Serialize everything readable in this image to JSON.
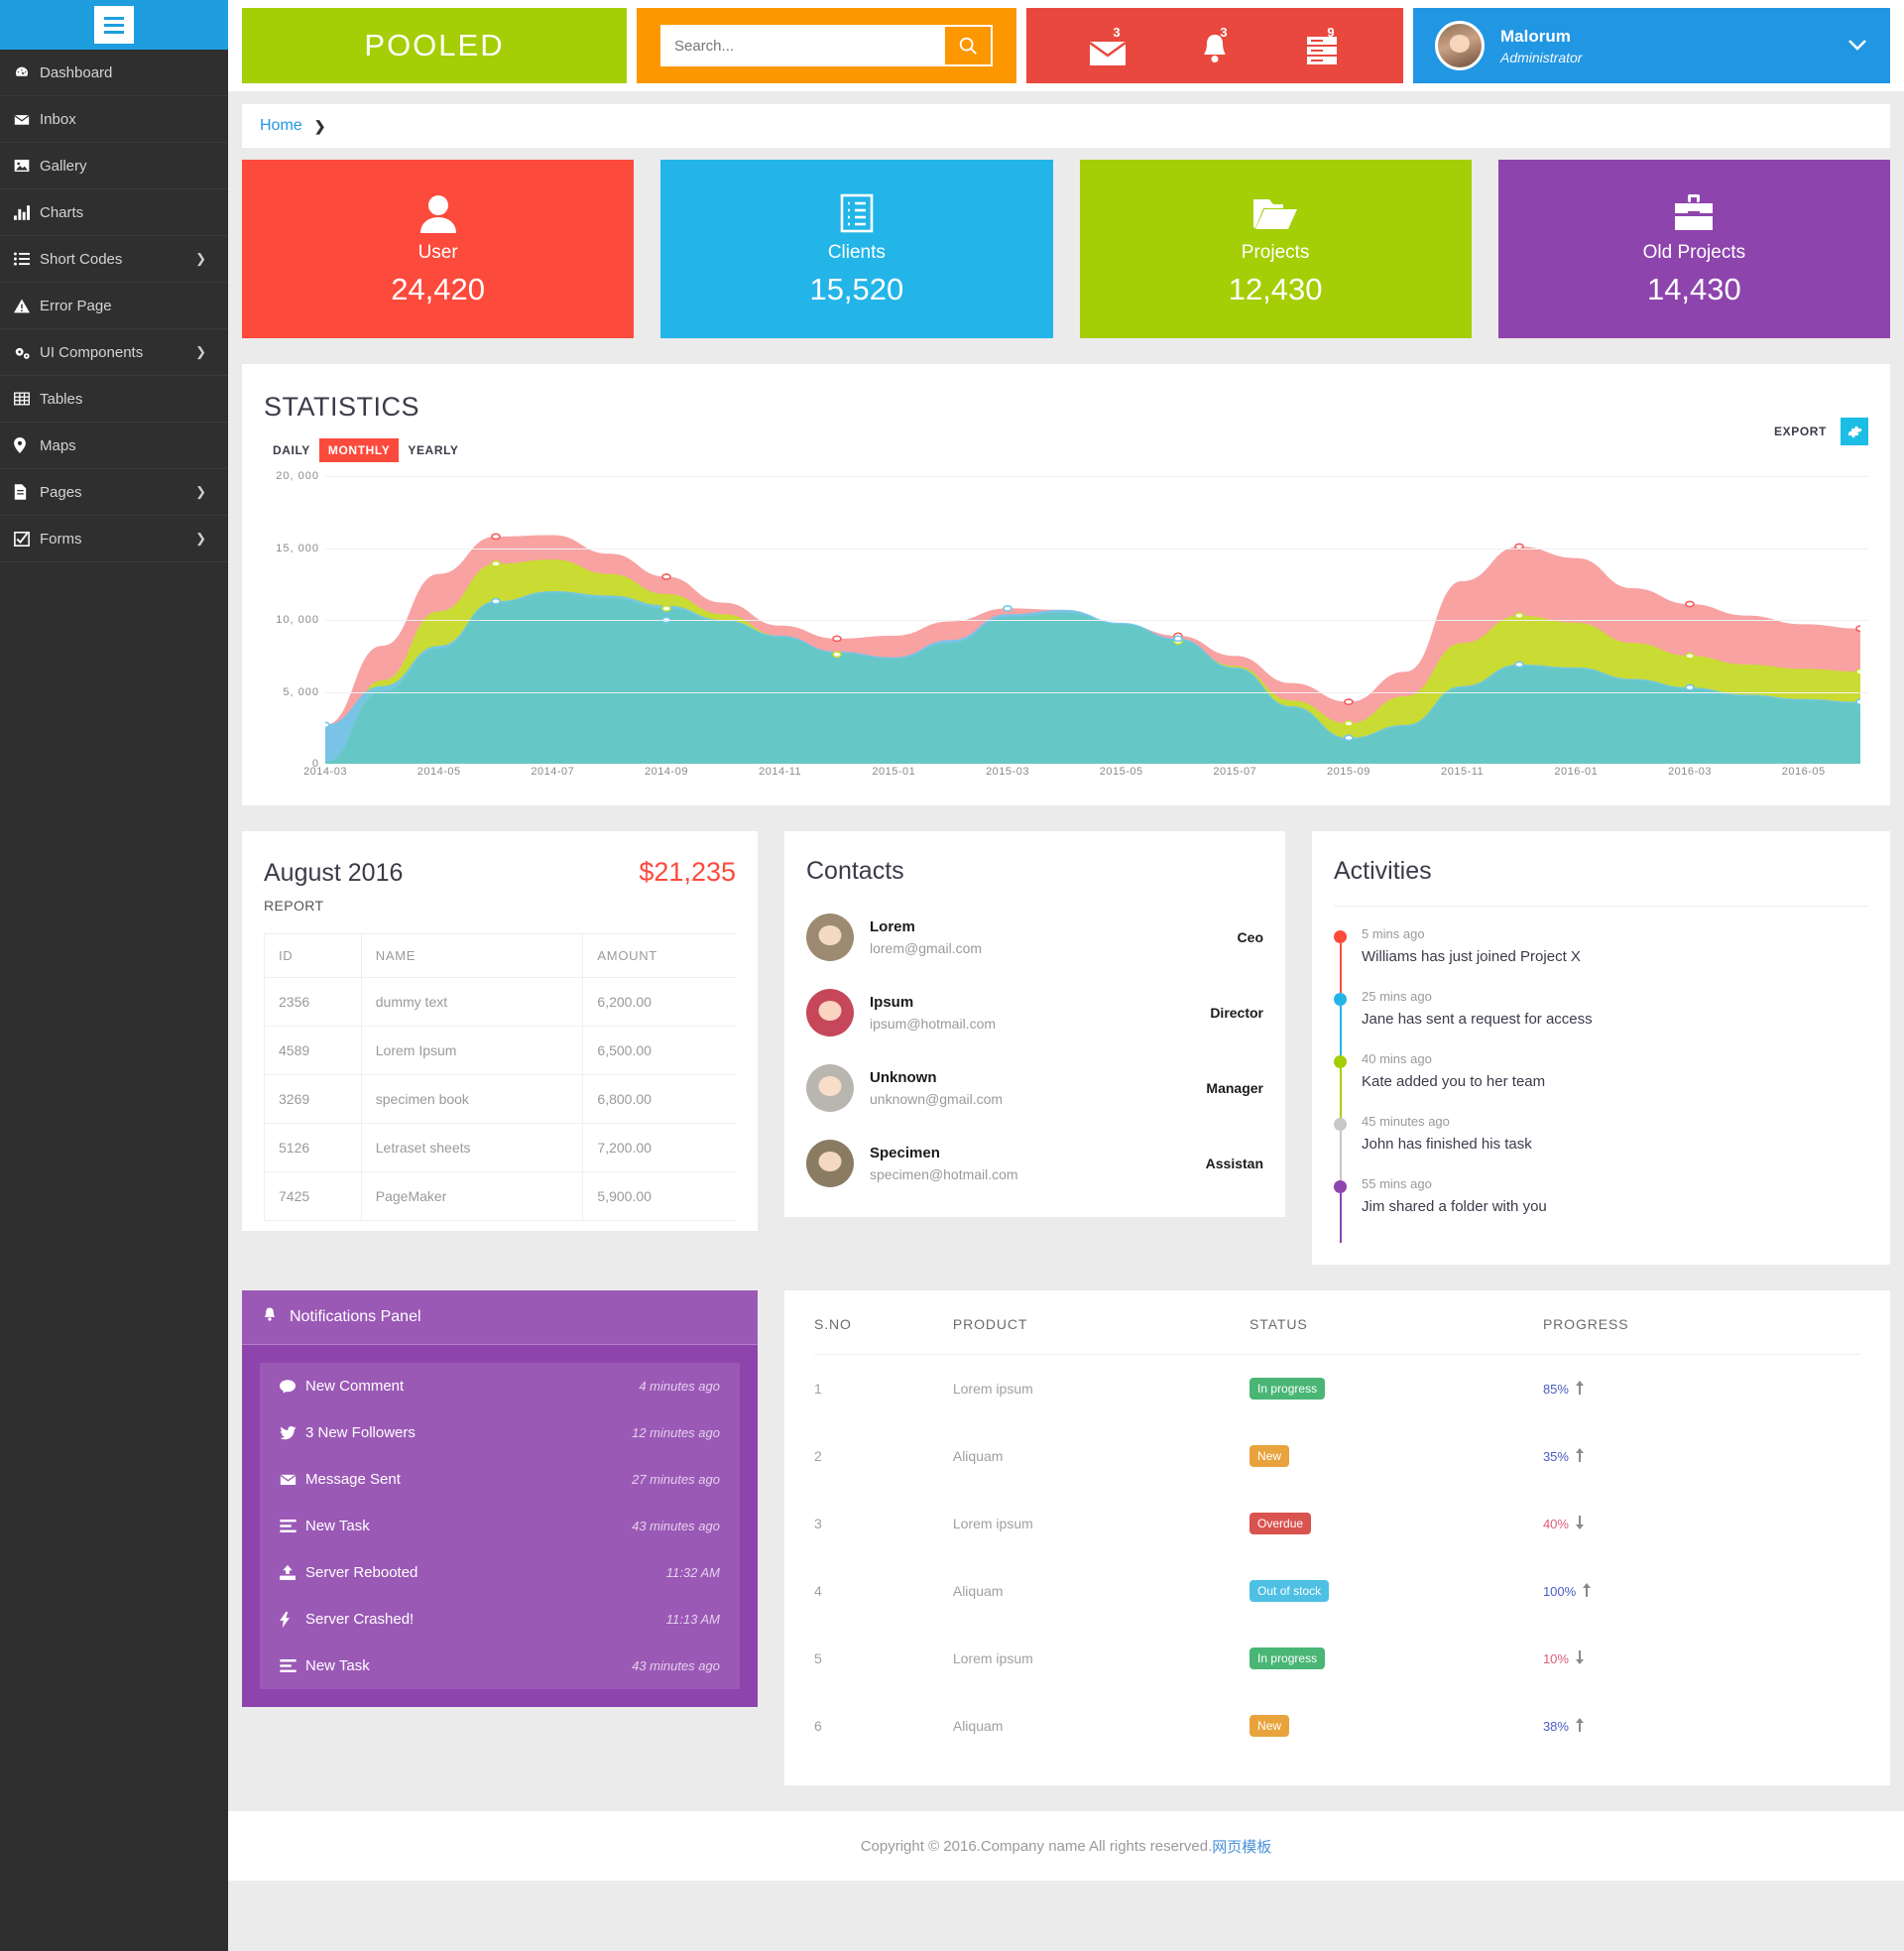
{
  "sidebar": {
    "menu_icon": "hamburger-icon",
    "items": [
      {
        "label": "Dashboard",
        "icon": "dashboard-icon",
        "arrow": ""
      },
      {
        "label": "Inbox",
        "icon": "envelope-icon",
        "arrow": ""
      },
      {
        "label": "Gallery",
        "icon": "image-icon",
        "arrow": ""
      },
      {
        "label": "Charts",
        "icon": "bar-chart-icon",
        "arrow": ""
      },
      {
        "label": "Short Codes",
        "icon": "list-icon",
        "arrow": "❯"
      },
      {
        "label": "Error Page",
        "icon": "warning-icon",
        "arrow": ""
      },
      {
        "label": "UI Components",
        "icon": "gears-icon",
        "arrow": "❯"
      },
      {
        "label": "Tables",
        "icon": "table-icon",
        "arrow": ""
      },
      {
        "label": "Maps",
        "icon": "map-pin-icon",
        "arrow": ""
      },
      {
        "label": "Pages",
        "icon": "file-icon",
        "arrow": "❯"
      },
      {
        "label": "Forms",
        "icon": "checkbox-icon",
        "arrow": "❯"
      }
    ]
  },
  "header": {
    "logo": "POOLED",
    "search": {
      "placeholder": "Search...",
      "value": "",
      "icon": "search-icon"
    },
    "alerts": [
      {
        "icon": "mail-icon",
        "count": "3",
        "badge_color": "#ee7b22"
      },
      {
        "icon": "bell-icon",
        "count": "3",
        "badge_color": "#1e75bb"
      },
      {
        "icon": "server-icon",
        "count": "9",
        "badge_color": "#6aa80e"
      }
    ],
    "user": {
      "name": "Malorum",
      "role": "Administrator",
      "avatar": "user-avatar",
      "caret": "chevron-down-icon"
    }
  },
  "breadcrumb": {
    "home": "Home",
    "separator": "❯"
  },
  "stat_cards": [
    {
      "label": "User",
      "value": "24,420",
      "color": "#fc4a3c",
      "icon": "person-icon"
    },
    {
      "label": "Clients",
      "value": "15,520",
      "color": "#23b5e8",
      "icon": "clipboard-list-icon"
    },
    {
      "label": "Projects",
      "value": "12,430",
      "color": "#a4ce06",
      "icon": "folder-open-icon"
    },
    {
      "label": "Old Projects",
      "value": "14,430",
      "color": "#8e44ad",
      "icon": "briefcase-icon"
    }
  ],
  "statistics": {
    "title": "STATISTICS",
    "ranges": [
      {
        "label": "DAILY",
        "active": false
      },
      {
        "label": "MONTHLY",
        "active": true
      },
      {
        "label": "YEARLY",
        "active": false
      }
    ],
    "export_label": "EXPORT",
    "settings_icon": "gear-icon"
  },
  "chart_data": {
    "type": "area",
    "title": "STATISTICS",
    "xlabel": "",
    "ylabel": "",
    "ylim": [
      0,
      20000
    ],
    "yticks": [
      0,
      5000,
      10000,
      15000,
      20000
    ],
    "ytick_labels": [
      "0",
      "5, 000",
      "10, 000",
      "15, 000",
      "20, 000"
    ],
    "grid": true,
    "legend": "none",
    "stacked": false,
    "x": [
      "2014-03",
      "2014-04",
      "2014-05",
      "2014-06",
      "2014-07",
      "2014-08",
      "2014-09",
      "2014-10",
      "2014-11",
      "2014-12",
      "2015-01",
      "2015-02",
      "2015-03",
      "2015-04",
      "2015-05",
      "2015-06",
      "2015-07",
      "2015-08",
      "2015-09",
      "2015-10",
      "2015-11",
      "2015-12",
      "2016-01",
      "2016-02",
      "2016-03",
      "2016-04",
      "2016-05",
      "2016-06"
    ],
    "xtick_labels": [
      "2014-03",
      "2014-05",
      "2014-07",
      "2014-09",
      "2014-11",
      "2015-01",
      "2015-03",
      "2015-05",
      "2015-07",
      "2015-09",
      "2015-11",
      "2016-01",
      "2016-03",
      "2016-05"
    ],
    "series": [
      {
        "name": "red",
        "color": "#f79a9a",
        "values": [
          2700,
          8200,
          13200,
          15800,
          15900,
          14600,
          13000,
          11200,
          9600,
          8700,
          8900,
          9900,
          10800,
          10700,
          9700,
          8900,
          7500,
          5600,
          4300,
          6400,
          12700,
          15100,
          14300,
          12200,
          11100,
          10300,
          9700,
          9400
        ]
      },
      {
        "name": "green",
        "color": "#c6e02a",
        "values": [
          200,
          5800,
          10600,
          13900,
          14200,
          13200,
          11800,
          10400,
          8900,
          7600,
          7000,
          7800,
          9400,
          10000,
          9300,
          8500,
          6800,
          4400,
          2800,
          4700,
          8400,
          10300,
          9800,
          8400,
          7500,
          6900,
          6600,
          6400
        ]
      },
      {
        "name": "blue",
        "color": "#6ec6ec",
        "values": [
          2700,
          5400,
          8200,
          11300,
          12000,
          11700,
          11000,
          10000,
          8900,
          7800,
          7400,
          8600,
          10400,
          10700,
          9800,
          8700,
          6700,
          4000,
          1800,
          2700,
          5400,
          6900,
          6700,
          5900,
          5300,
          4800,
          4500,
          4300
        ]
      },
      {
        "name": "teal",
        "color": "#64c8c3",
        "values": [
          100,
          5000,
          8000,
          11200,
          11900,
          11500,
          10800,
          9900,
          8800,
          7700,
          7300,
          8400,
          10200,
          10500,
          9700,
          8600,
          6600,
          3900,
          1700,
          2600,
          5300,
          6800,
          6600,
          5800,
          5200,
          4700,
          4400,
          4200
        ]
      }
    ],
    "markers": [
      {
        "x": "2014-03",
        "y": 2700,
        "color": "#6ec6ec"
      },
      {
        "x": "2014-06",
        "y": 15800,
        "color": "#f35c5c"
      },
      {
        "x": "2014-06",
        "y": 13900,
        "color": "#c6e02a"
      },
      {
        "x": "2014-06",
        "y": 11300,
        "color": "#6ec6ec"
      },
      {
        "x": "2014-09",
        "y": 13000,
        "color": "#f35c5c"
      },
      {
        "x": "2014-09",
        "y": 10800,
        "color": "#c6e02a"
      },
      {
        "x": "2014-09",
        "y": 10000,
        "color": "#6ec6ec"
      },
      {
        "x": "2014-12",
        "y": 8700,
        "color": "#f35c5c"
      },
      {
        "x": "2014-12",
        "y": 7600,
        "color": "#c6e02a"
      },
      {
        "x": "2015-03",
        "y": 10800,
        "color": "#6ec6ec"
      },
      {
        "x": "2015-06",
        "y": 8900,
        "color": "#f35c5c"
      },
      {
        "x": "2015-06",
        "y": 8500,
        "color": "#c6e02a"
      },
      {
        "x": "2015-06",
        "y": 8700,
        "color": "#6ec6ec"
      },
      {
        "x": "2015-09",
        "y": 4300,
        "color": "#f35c5c"
      },
      {
        "x": "2015-09",
        "y": 2800,
        "color": "#c6e02a"
      },
      {
        "x": "2015-09",
        "y": 1800,
        "color": "#6ec6ec"
      },
      {
        "x": "2015-12",
        "y": 15100,
        "color": "#f35c5c"
      },
      {
        "x": "2015-12",
        "y": 10300,
        "color": "#c6e02a"
      },
      {
        "x": "2015-12",
        "y": 6900,
        "color": "#6ec6ec"
      },
      {
        "x": "2016-03",
        "y": 11100,
        "color": "#f35c5c"
      },
      {
        "x": "2016-03",
        "y": 7500,
        "color": "#c6e02a"
      },
      {
        "x": "2016-03",
        "y": 5300,
        "color": "#6ec6ec"
      },
      {
        "x": "2016-06",
        "y": 9400,
        "color": "#f35c5c"
      },
      {
        "x": "2016-06",
        "y": 6400,
        "color": "#c6e02a"
      },
      {
        "x": "2016-06",
        "y": 4300,
        "color": "#6ec6ec"
      }
    ]
  },
  "report": {
    "title": "August 2016",
    "amount": "$21,235",
    "subtitle": "REPORT",
    "columns": [
      "ID",
      "NAME",
      "AMOUNT"
    ],
    "rows": [
      [
        "2356",
        "dummy text",
        "6,200.00"
      ],
      [
        "4589",
        "Lorem Ipsum",
        "6,500.00"
      ],
      [
        "3269",
        "specimen book",
        "6,800.00"
      ],
      [
        "5126",
        "Letraset sheets",
        "7,200.00"
      ],
      [
        "7425",
        "PageMaker",
        "5,900.00"
      ]
    ]
  },
  "contacts": {
    "title": "Contacts",
    "items": [
      {
        "name": "Lorem",
        "email": "lorem@gmail.com",
        "role": "Ceo",
        "avatar_color": "#9c8a72"
      },
      {
        "name": "Ipsum",
        "email": "ipsum@hotmail.com",
        "role": "Director",
        "avatar_color": "#c6475a"
      },
      {
        "name": "Unknown",
        "email": "unknown@gmail.com",
        "role": "Manager",
        "avatar_color": "#b9b6b0"
      },
      {
        "name": "Specimen",
        "email": "specimen@hotmail.com",
        "role": "Assistan",
        "avatar_color": "#8a7b63"
      }
    ]
  },
  "activities": {
    "title": "Activities",
    "items": [
      {
        "time": "5 mins ago",
        "text": "Williams has just joined Project X",
        "color": "#fc4a3c"
      },
      {
        "time": "25 mins ago",
        "text": "Jane has sent a request for access",
        "color": "#23b5e8"
      },
      {
        "time": "40 mins ago",
        "text": "Kate added you to her team",
        "color": "#a4ce06"
      },
      {
        "time": "45 minutes ago",
        "text": "John has finished his task",
        "color": "#c7c7c7"
      },
      {
        "time": "55 mins ago",
        "text": "Jim shared a folder with you",
        "color": "#8e44ad"
      }
    ]
  },
  "notifications": {
    "title": "Notifications Panel",
    "header_icon": "bell-icon",
    "items": [
      {
        "label": "New Comment",
        "time": "4 minutes ago",
        "icon": "comment-icon"
      },
      {
        "label": "3 New Followers",
        "time": "12 minutes ago",
        "icon": "twitter-icon"
      },
      {
        "label": "Message Sent",
        "time": "27 minutes ago",
        "icon": "envelope-icon"
      },
      {
        "label": "New Task",
        "time": "43 minutes ago",
        "icon": "tasks-icon"
      },
      {
        "label": "Server Rebooted",
        "time": "11:32 AM",
        "icon": "upload-icon"
      },
      {
        "label": "Server Crashed!",
        "time": "11:13 AM",
        "icon": "bolt-icon"
      },
      {
        "label": "New Task",
        "time": "43 minutes ago",
        "icon": "tasks-icon"
      }
    ]
  },
  "products": {
    "columns": [
      "S.NO",
      "PRODUCT",
      "STATUS",
      "PROGRESS"
    ],
    "rows": [
      {
        "no": "1",
        "product": "Lorem ipsum",
        "status": "In progress",
        "status_color": "#49b675",
        "progress": "85%",
        "trend": "up",
        "progress_color": "#4a5bc4"
      },
      {
        "no": "2",
        "product": "Aliquam",
        "status": "New",
        "status_color": "#e8a33d",
        "progress": "35%",
        "trend": "up",
        "progress_color": "#4a5bc4"
      },
      {
        "no": "3",
        "product": "Lorem ipsum",
        "status": "Overdue",
        "status_color": "#d9534f",
        "progress": "40%",
        "trend": "down",
        "progress_color": "#e05c7a"
      },
      {
        "no": "4",
        "product": "Aliquam",
        "status": "Out of stock",
        "status_color": "#4ec0e4",
        "progress": "100%",
        "trend": "up",
        "progress_color": "#4a5bc4"
      },
      {
        "no": "5",
        "product": "Lorem ipsum",
        "status": "In progress",
        "status_color": "#49b675",
        "progress": "10%",
        "trend": "down",
        "progress_color": "#e05c7a"
      },
      {
        "no": "6",
        "product": "Aliquam",
        "status": "New",
        "status_color": "#e8a33d",
        "progress": "38%",
        "trend": "up",
        "progress_color": "#4a5bc4"
      }
    ]
  },
  "footer": {
    "text": "Copyright © 2016.Company name All rights reserved.",
    "link": "网页模板"
  }
}
